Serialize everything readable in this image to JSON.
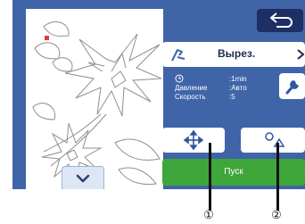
{
  "cut_panel": {
    "button_label": "Вырез.",
    "settings": [
      {
        "label": "",
        "value": ":1min",
        "icon": "clock-icon"
      },
      {
        "label": "Давление",
        "value": ":Авто"
      },
      {
        "label": "Скорость",
        "value": ":5"
      }
    ]
  },
  "start_button": {
    "label": "Пуск"
  },
  "callouts": {
    "one": "①",
    "two": "②"
  },
  "colors": {
    "screen_bg": "#3f64a8",
    "start_green": "#3ea63a",
    "back_dark": "#1d2f63"
  }
}
